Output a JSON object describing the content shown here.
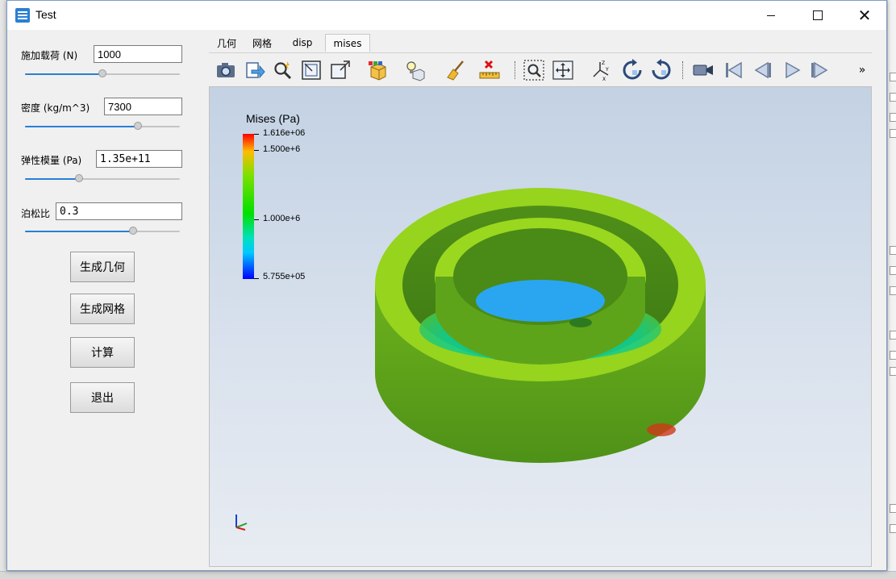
{
  "window": {
    "title": "Test"
  },
  "params": {
    "load": {
      "label": "施加载荷 (N)",
      "value": "1000",
      "slider": 0.5
    },
    "density": {
      "label": "密度 (kg/m^3)",
      "value": "7300",
      "slider": 0.73
    },
    "modulus": {
      "label": "弹性模量 (Pa)",
      "value": "1.35e+11",
      "slider": 0.35
    },
    "poisson": {
      "label": "泊松比",
      "value": "0.3",
      "slider": 0.7
    }
  },
  "buttons": {
    "gen_geometry": "生成几何",
    "gen_mesh": "生成网格",
    "compute": "计算",
    "exit": "退出"
  },
  "tabs": [
    {
      "label": "几何",
      "active": false
    },
    {
      "label": "网格",
      "active": false
    },
    {
      "label": "disp",
      "active": false
    },
    {
      "label": "mises",
      "active": true
    }
  ],
  "toolbar": {
    "icons": [
      "camera-icon",
      "export-icon",
      "interact-icon",
      "reset-camera-icon",
      "zoom-box-icon",
      "color-cube-icon",
      "light-bulb-icon",
      "clear-brush-icon",
      "measure-icon",
      "zoom-to-box-icon",
      "pan-icon",
      "axes-icon",
      "rotate-cw-icon",
      "rotate-ccw-icon",
      "video-icon",
      "first-frame-icon",
      "prev-frame-icon",
      "play-icon",
      "last-frame-icon"
    ],
    "overflow": "»"
  },
  "legend": {
    "title": "Mises (Pa)",
    "max": "1.616e+06",
    "min": "5.755e+05",
    "ticks": [
      "1.500e+6",
      "1.000e+6",
      "5.755e+05"
    ],
    "colors": [
      "#ff0000",
      "#ffbb00",
      "#00e000",
      "#00c8ff",
      "#0000ff"
    ]
  },
  "colors": {
    "accent": "#2a7fd4",
    "mesh_green": "#6fb81a",
    "mesh_rim": "#8fd81e"
  }
}
